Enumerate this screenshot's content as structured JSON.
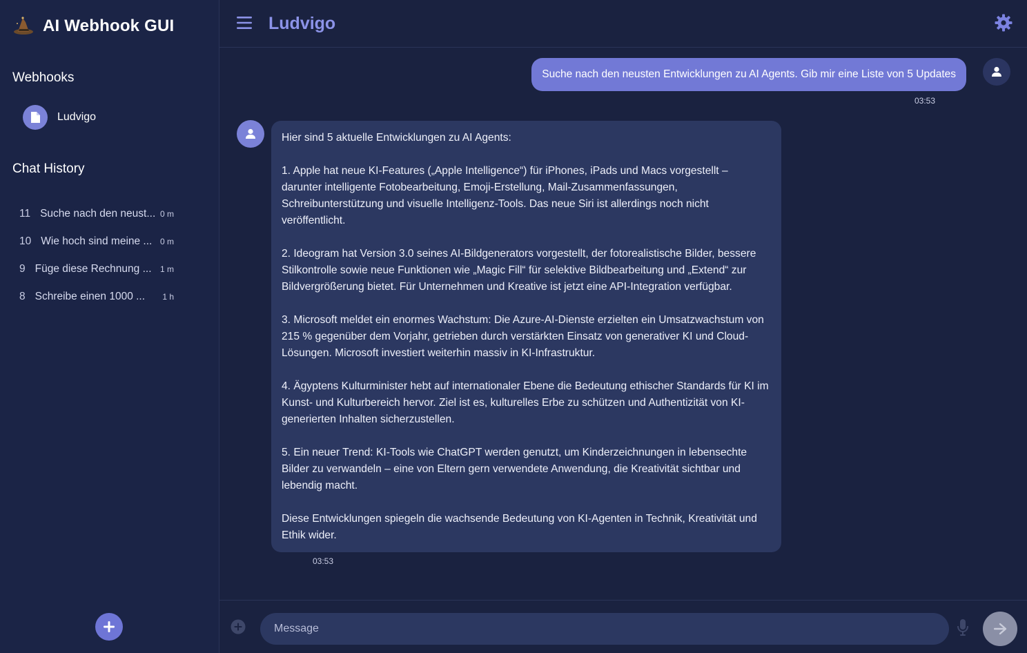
{
  "app": {
    "title": "AI Webhook GUI",
    "accent_color": "#7279d6",
    "background_color": "#1a2240"
  },
  "sidebar": {
    "webhooks_heading": "Webhooks",
    "webhooks": [
      {
        "label": "Ludvigo",
        "icon": "document-icon"
      }
    ],
    "history_heading": "Chat History",
    "history": [
      {
        "number": "11",
        "text": "Suche nach den neust...",
        "time": "0 m"
      },
      {
        "number": "10",
        "text": "Wie hoch sind meine ...",
        "time": "0 m"
      },
      {
        "number": "9",
        "text": "Füge diese Rechnung ...",
        "time": "1 m"
      },
      {
        "number": "8",
        "text": "Schreibe einen 1000 ...",
        "time": "1 h"
      }
    ],
    "new_chat_icon": "plus-icon"
  },
  "header": {
    "chat_title": "Ludvigo",
    "menu_icon": "hamburger-menu-icon",
    "settings_icon": "gear-icon"
  },
  "messages": {
    "user": {
      "text": "Suche nach den neusten Entwicklungen zu AI Agents. Gib mir eine Liste von 5 Updates",
      "time": "03:53"
    },
    "assistant": {
      "paragraphs": [
        "Hier sind 5 aktuelle Entwicklungen zu AI Agents:",
        "1. Apple hat neue KI-Features („Apple Intelligence“) für iPhones, iPads und Macs vorgestellt – darunter intelligente Fotobearbeitung, Emoji-Erstellung, Mail-Zusammenfassungen, Schreibunterstützung und visuelle Intelligenz-Tools. Das neue Siri ist allerdings noch nicht veröffentlicht.",
        "2. Ideogram hat Version 3.0 seines AI-Bildgenerators vorgestellt, der fotorealistische Bilder, bessere Stilkontrolle sowie neue Funktionen wie „Magic Fill“ für selektive Bildbearbeitung und „Extend“ zur Bildvergrößerung bietet. Für Unternehmen und Kreative ist jetzt eine API-Integration verfügbar.",
        "3. Microsoft meldet ein enormes Wachstum: Die Azure-AI-Dienste erzielten ein Umsatzwachstum von 215 % gegenüber dem Vorjahr, getrieben durch verstärkten Einsatz von generativer KI und Cloud-Lösungen. Microsoft investiert weiterhin massiv in KI-Infrastruktur.",
        "4. Ägyptens Kulturminister hebt auf internationaler Ebene die Bedeutung ethischer Standards für KI im Kunst- und Kulturbereich hervor. Ziel ist es, kulturelles Erbe zu schützen und Authentizität von KI-generierten Inhalten sicherzustellen.",
        "5. Ein neuer Trend: KI-Tools wie ChatGPT werden genutzt, um Kinderzeichnungen in lebensechte Bilder zu verwandeln – eine von Eltern gern verwendete Anwendung, die Kreativität sichtbar und lebendig macht.",
        "Diese Entwicklungen spiegeln die wachsende Bedeutung von KI-Agenten in Technik, Kreativität und Ethik wider."
      ],
      "time": "03:53"
    }
  },
  "composer": {
    "placeholder": "Message",
    "attach_icon": "plus-circle-icon",
    "mic_icon": "microphone-icon",
    "send_icon": "arrow-right-icon"
  }
}
